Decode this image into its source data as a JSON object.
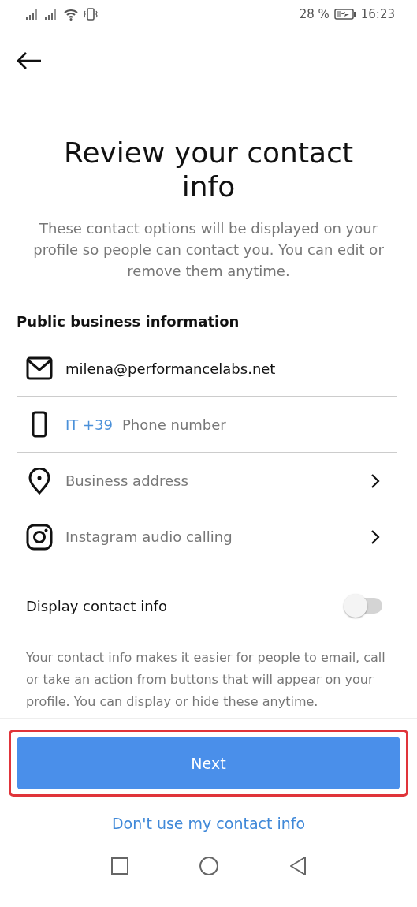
{
  "status_bar": {
    "battery": "28 %",
    "time": "16:23"
  },
  "title": "Review your contact info",
  "subtitle": "These contact options will be displayed on your profile so people can contact you. You can edit or remove them anytime.",
  "section_title": "Public business information",
  "contact_rows": [
    {
      "kind": "email",
      "value": "milena@performancelabs.net"
    },
    {
      "kind": "phone",
      "prefix": "IT +39",
      "placeholder": "Phone number"
    },
    {
      "kind": "address",
      "label": "Business address"
    },
    {
      "kind": "calling",
      "label": "Instagram audio calling"
    }
  ],
  "display_toggle": {
    "label": "Display contact info",
    "on": false
  },
  "note": "Your contact info makes it easier for people to email, call or take an action from buttons that will appear on your profile. You can display or hide these anytime.",
  "next_button": {
    "label": "Next",
    "highlighted": true
  },
  "skip_link": "Don't use my contact info"
}
